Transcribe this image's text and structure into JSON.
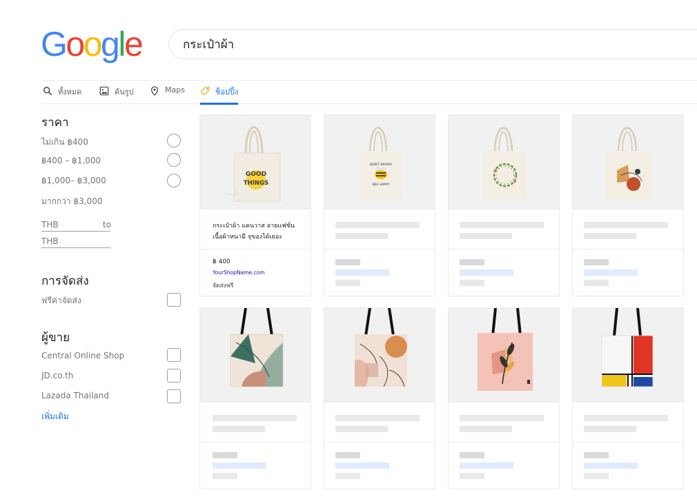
{
  "logo": {
    "letters": [
      "G",
      "o",
      "o",
      "g",
      "l",
      "e"
    ],
    "colors": [
      "#4285f4",
      "#ea4335",
      "#fbbc05",
      "#4285f4",
      "#34a853",
      "#ea4335"
    ]
  },
  "search": {
    "query": "กระเป๋าผ้า"
  },
  "tabs": [
    {
      "label": "ทั้งหมด",
      "icon": "search-icon",
      "active": false
    },
    {
      "label": "ค้นรูป",
      "icon": "image-icon",
      "active": false
    },
    {
      "label": "Maps",
      "icon": "map-pin-icon",
      "active": false
    },
    {
      "label": "ช็อปปิ้ง",
      "icon": "tag-icon",
      "active": true
    }
  ],
  "sidebar": {
    "price": {
      "title": "ราคา",
      "options": [
        "ไม่เกิน ฿400",
        "฿400 – ฿1,000",
        "฿1,000– ฿3,000",
        "มากกว่า ฿3,000"
      ],
      "range_from": "THB",
      "range_to_label": "to",
      "range_to": "THB"
    },
    "shipping": {
      "title": "การจัดส่ง",
      "options": [
        "ฟรีค่าจัดส่ง"
      ]
    },
    "seller": {
      "title": "ผู้ขาย",
      "options": [
        "Central Online Shop",
        "JD.co.th",
        "Lazada Thailand"
      ],
      "more": "เพิ่มเติม"
    }
  },
  "products": [
    {
      "title": "กระเป๋าผ้า แคนวาส ลายแฟชั่น เนื้อผ้าหนามี จุของได้เยอะ",
      "price": "฿ 400",
      "shop": "YourShopName.com",
      "shipping": "จัดส่งฟรี",
      "image": "good-things-tote",
      "bag_text": [
        "GOOD",
        "THINGS"
      ]
    },
    {
      "image": "bee-happy-tote",
      "bag_text": [
        "DON'T WORRY",
        "BEE HAPPY"
      ]
    },
    {
      "image": "leaf-wreath-tote"
    },
    {
      "image": "abstract-shapes-tote"
    },
    {
      "image": "palm-leaves-tote"
    },
    {
      "image": "boho-leaf-tote"
    },
    {
      "image": "pink-plant-tote"
    },
    {
      "image": "mondrian-tote"
    }
  ],
  "colors": {
    "accent": "#1a73e8",
    "link": "#1a0dab",
    "placeholder": "#e8e8e8",
    "placeholder_blue": "#e2eafd"
  }
}
